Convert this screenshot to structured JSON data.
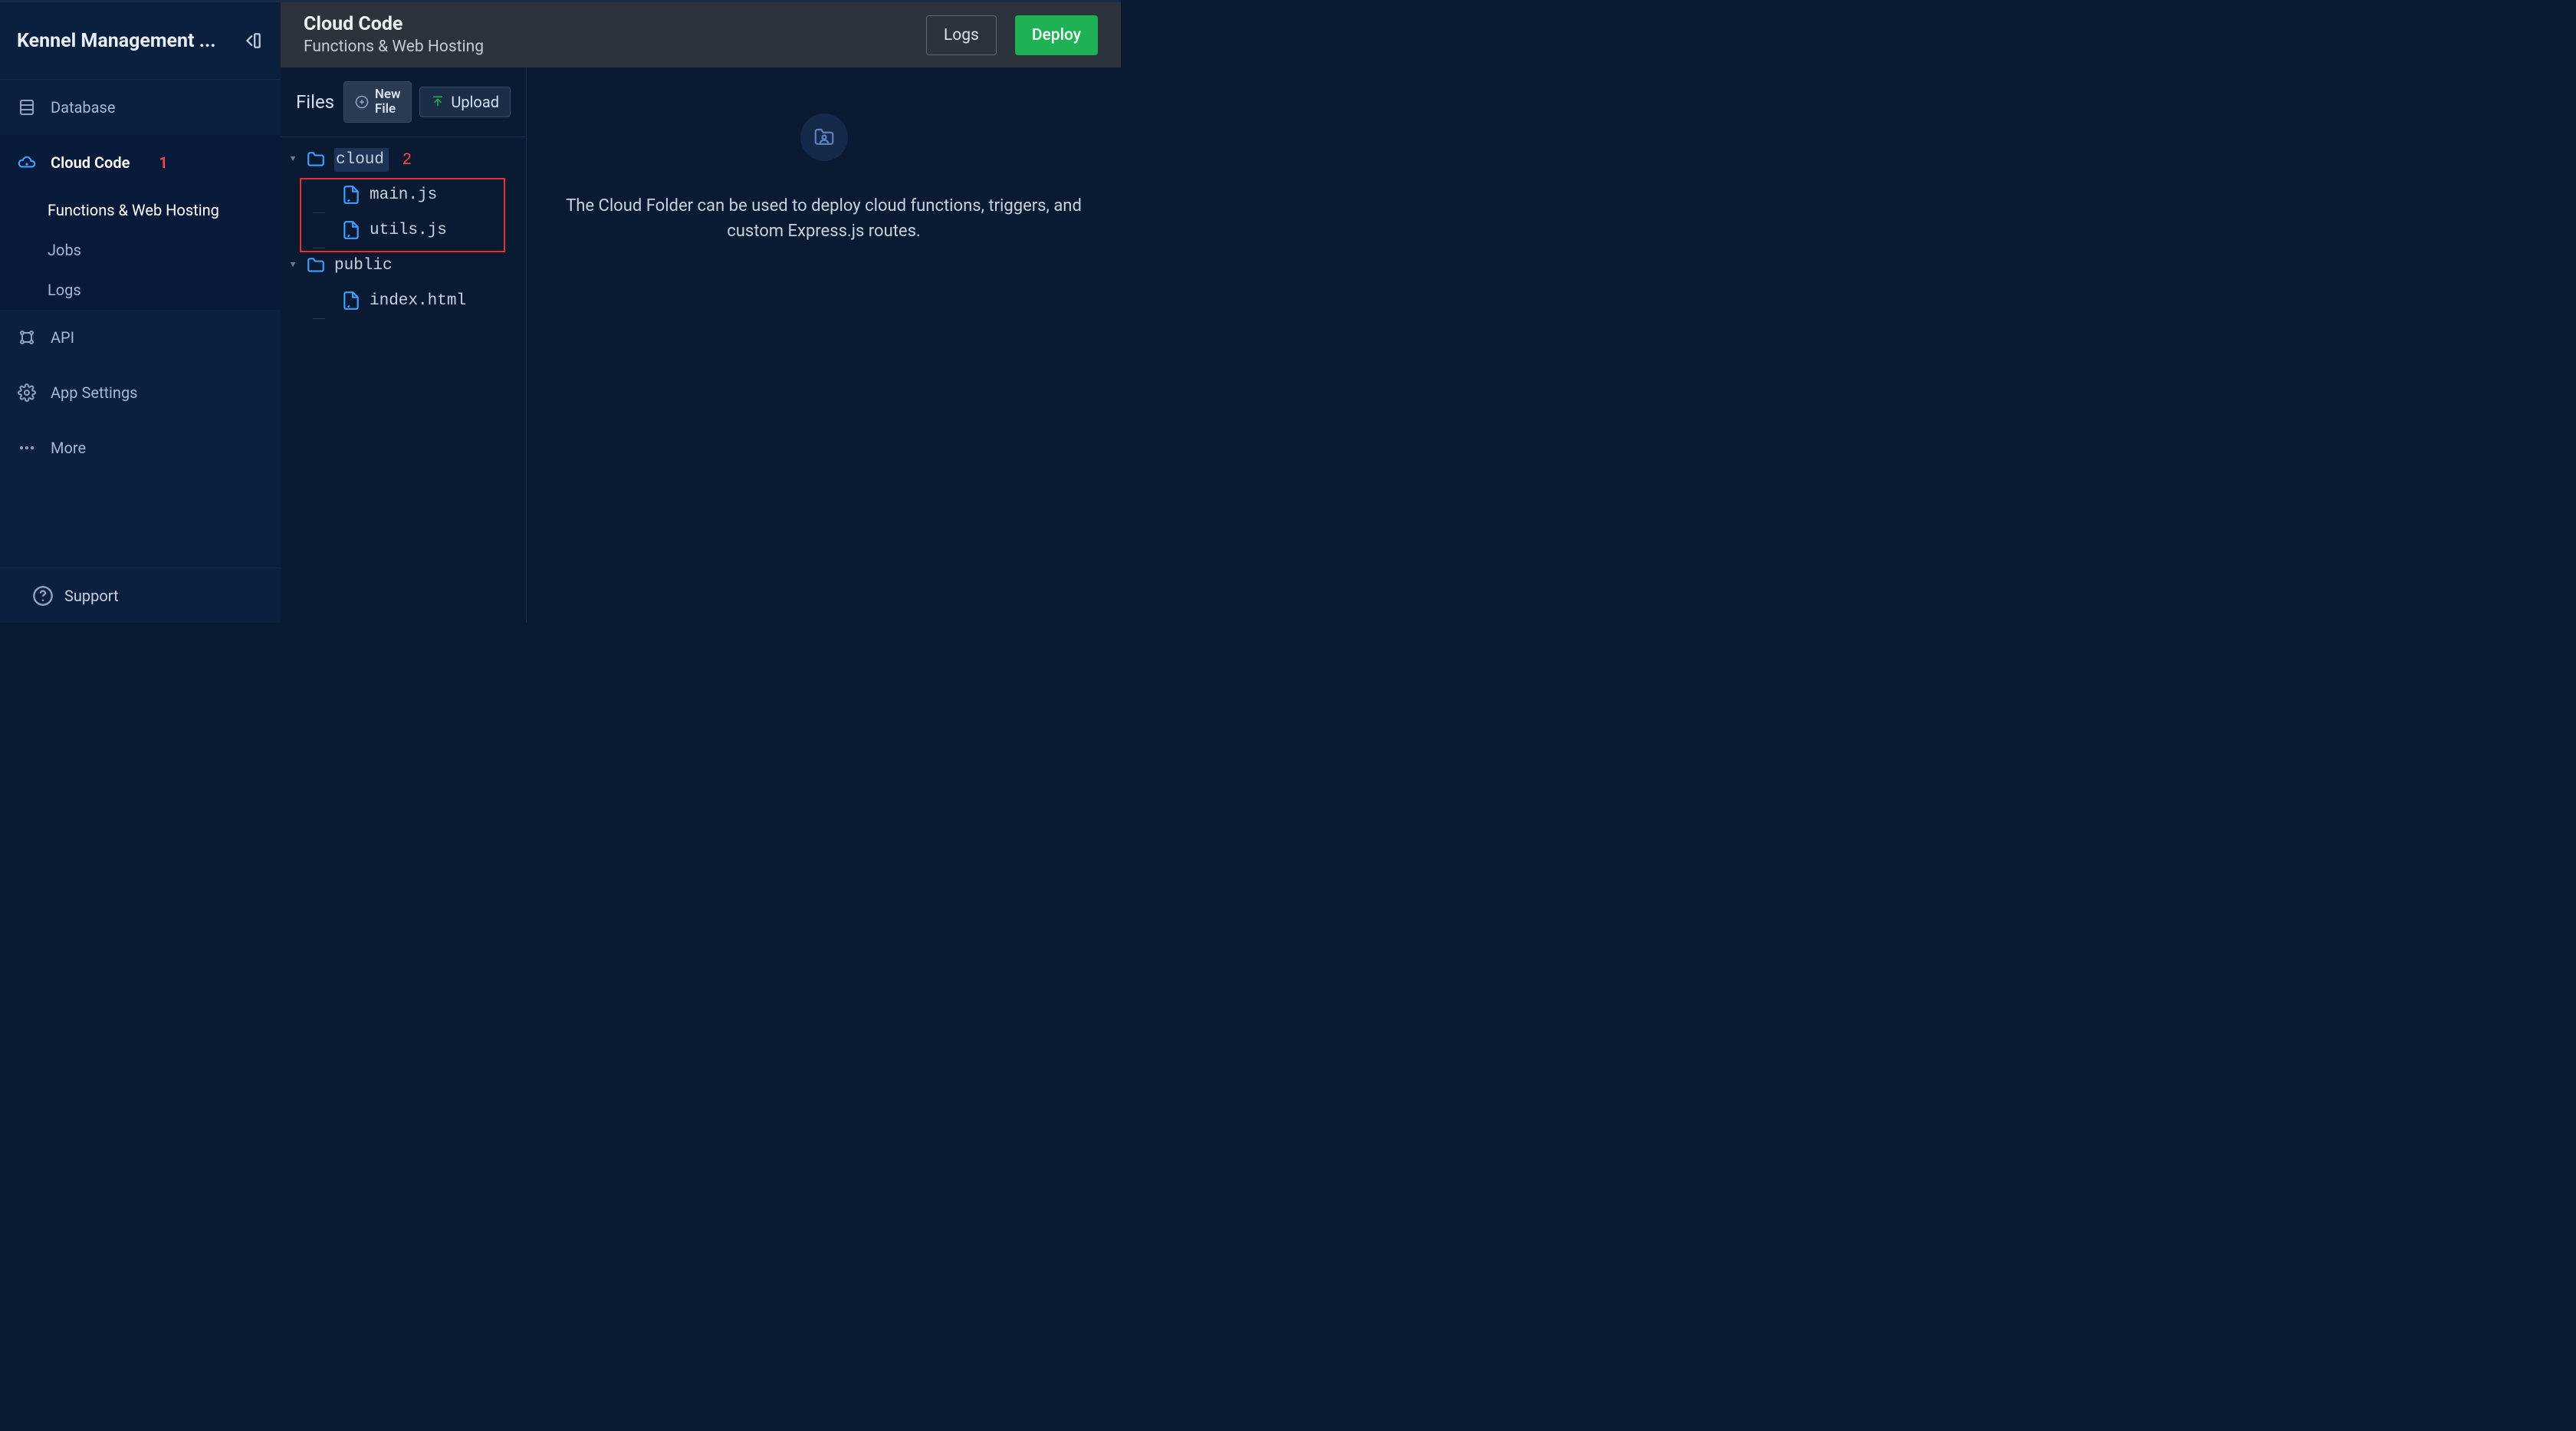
{
  "app": {
    "title": "Kennel Management ..."
  },
  "sidebar": {
    "items": [
      {
        "label": "Database"
      },
      {
        "label": "Cloud Code",
        "badge": "1"
      },
      {
        "label": "API"
      },
      {
        "label": "App Settings"
      },
      {
        "label": "More"
      }
    ],
    "sub": [
      {
        "label": "Functions & Web Hosting"
      },
      {
        "label": "Jobs"
      },
      {
        "label": "Logs"
      }
    ],
    "support": "Support"
  },
  "header": {
    "title": "Cloud Code",
    "subtitle": "Functions & Web Hosting",
    "logs": "Logs",
    "deploy": "Deploy"
  },
  "files": {
    "tab": "Files",
    "new_file": "New\nFile",
    "upload": "Upload",
    "tree": {
      "cloud": {
        "name": "cloud",
        "badge": "2",
        "files": [
          {
            "name": "main.js"
          },
          {
            "name": "utils.js"
          }
        ]
      },
      "public": {
        "name": "public",
        "files": [
          {
            "name": "index.html"
          }
        ]
      }
    }
  },
  "details": {
    "text": "The Cloud Folder can be used to deploy cloud functions, triggers, and custom Express.js routes."
  }
}
